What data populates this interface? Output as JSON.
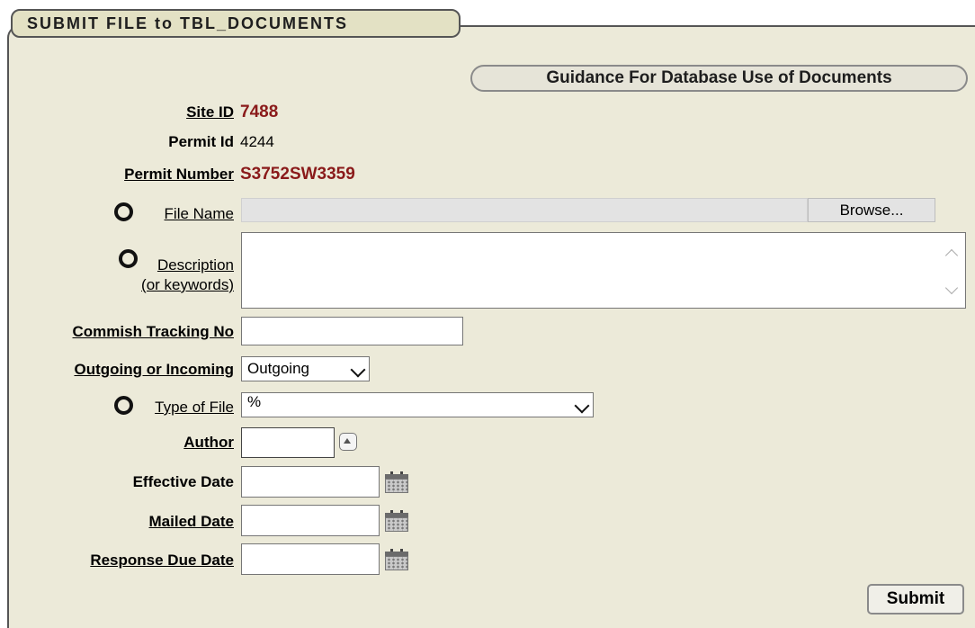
{
  "header": {
    "title": "SUBMIT FILE to TBL_DOCUMENTS"
  },
  "guidance_button": {
    "label": "Guidance For Database Use of Documents"
  },
  "site": {
    "label": "Site ID",
    "value": "7488"
  },
  "permit_id": {
    "label": "Permit Id",
    "value": "4244"
  },
  "permit_number": {
    "label": "Permit Number",
    "value": "S3752SW3359"
  },
  "file_name": {
    "label": "File Name",
    "value": "",
    "browse_label": "Browse..."
  },
  "description": {
    "label": "Description",
    "sublabel": "(or keywords)",
    "value": ""
  },
  "commish_tracking": {
    "label": "Commish Tracking No",
    "value": ""
  },
  "outgoing_incoming": {
    "label": "Outgoing or Incoming",
    "selected": "Outgoing"
  },
  "type_of_file": {
    "label": "Type of File",
    "selected": "%"
  },
  "author": {
    "label": "Author",
    "value": ""
  },
  "effective_date": {
    "label": "Effective Date",
    "value": ""
  },
  "mailed_date": {
    "label": "Mailed Date",
    "value": ""
  },
  "response_due_date": {
    "label": "Response Due Date",
    "value": ""
  },
  "submit": {
    "label": "Submit"
  },
  "colors": {
    "panel_bg": "#ecead9",
    "accent_red": "#8a1a1a"
  },
  "icons": [
    "required-ring-icon",
    "calendar-icon",
    "lookup-arrow-icon",
    "chevron-down-icon",
    "chevron-up-icon"
  ]
}
